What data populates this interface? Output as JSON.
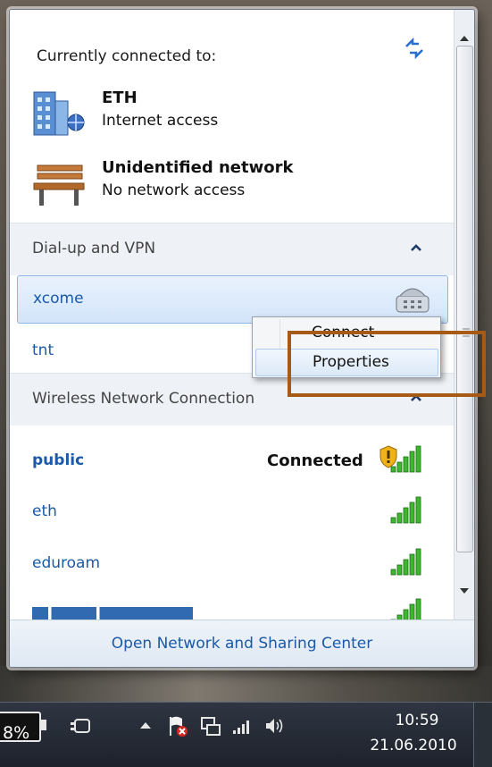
{
  "header": {
    "title": "Currently connected to:"
  },
  "connections": [
    {
      "name": "ETH",
      "status": "Internet access",
      "icon": "building-network-icon"
    },
    {
      "name": "Unidentified network",
      "status": "No network access",
      "icon": "park-bench-icon"
    }
  ],
  "dialup": {
    "label": "Dial-up and VPN",
    "items": [
      {
        "name": "xcome",
        "selected": true
      },
      {
        "name": "tnt"
      }
    ]
  },
  "wireless": {
    "label": "Wireless Network Connection",
    "items": [
      {
        "name": "public",
        "status": "Connected",
        "secured": true
      },
      {
        "name": "eth"
      },
      {
        "name": "eduroam"
      }
    ]
  },
  "context_menu": {
    "items": [
      "Connect",
      "Properties"
    ],
    "highlighted": "Properties"
  },
  "footer": {
    "link": "Open Network and Sharing Center"
  },
  "taskbar": {
    "battery_percent": "8%",
    "time": "10:59",
    "date": "21.06.2010"
  },
  "colors": {
    "link": "#1a5aa8",
    "highlight_box": "#a65a16",
    "signal": "#3db72e"
  }
}
